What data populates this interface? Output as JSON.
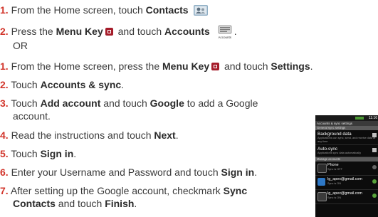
{
  "steps": [
    {
      "num": "1.",
      "pre": "From the Home screen, touch ",
      "bold": "Contacts",
      "icon": "contacts-icon"
    },
    {
      "num": "2.",
      "pre": "Press the ",
      "bold": "Menu Key",
      "mid": " and touch ",
      "bold2": "Accounts",
      "icon": "accounts-icon",
      "icon_caption": "Accounts",
      "end": "."
    },
    {
      "or": "OR"
    },
    {
      "num": "1.",
      "pre": "From the Home screen, press the ",
      "bold": "Menu Key",
      "mid": " and touch ",
      "bold2": "Settings",
      "end": "."
    },
    {
      "num": "2.",
      "pre": "Touch ",
      "bold": "Accounts & sync",
      "end": "."
    },
    {
      "num": "3.",
      "pre": "Touch ",
      "bold": "Add account",
      "mid": " and touch ",
      "bold2": "Google",
      "end": " to add a Google",
      "cont": "account."
    },
    {
      "num": "4.",
      "pre": "Read the instructions and touch ",
      "bold": "Next",
      "end": "."
    },
    {
      "num": "5.",
      "pre": "Touch ",
      "bold": "Sign in",
      "end": "."
    },
    {
      "num": "6.",
      "pre": "Enter your Username and Password and touch ",
      "bold": "Sign in",
      "end": "."
    },
    {
      "num": "7.",
      "pre": "After setting up the Google account, checkmark ",
      "bold": "Sync",
      "cont_bold": "Contacts",
      "cont_mid": " and touch ",
      "cont_bold2": "Finish",
      "cont_end": "."
    }
  ],
  "phone": {
    "clock": "11:16",
    "title": "Accounts & sync settings",
    "general_header": "General sync settings",
    "background_data": {
      "title": "Background data",
      "sub": "Applications can sync, send, and receive data at any time"
    },
    "auto_sync": {
      "title": "Auto-sync",
      "sub": "Applications sync data automatically"
    },
    "manage_header": "Manage accounts",
    "accounts": [
      {
        "name": "Phone",
        "status": "Sync is OFF"
      },
      {
        "name": "lg_apex@gmail.com",
        "status": "Sync is ON"
      },
      {
        "name": "lg_apex@gmail.com",
        "status": "Sync is ON"
      }
    ]
  }
}
